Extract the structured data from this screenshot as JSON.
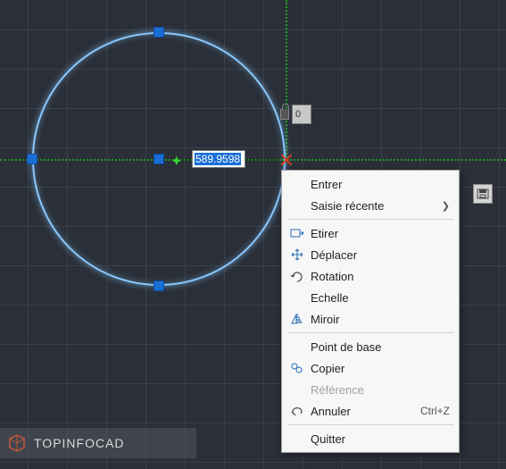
{
  "dynamic_input": {
    "value": "589.9598"
  },
  "angle_input": {
    "value": "0"
  },
  "context_menu": {
    "items": [
      {
        "label": "Entrer"
      },
      {
        "label": "Saisie récente",
        "submenu": true
      }
    ],
    "items2": [
      {
        "label": "Etirer",
        "icon": "stretch"
      },
      {
        "label": "Déplacer",
        "icon": "move"
      },
      {
        "label": "Rotation",
        "icon": "rotate"
      },
      {
        "label": "Echelle"
      },
      {
        "label": "Miroir",
        "icon": "mirror"
      }
    ],
    "items3": [
      {
        "label": "Point de base"
      },
      {
        "label": "Copier",
        "icon": "copy"
      },
      {
        "label": "Référence",
        "disabled": true
      },
      {
        "label": "Annuler",
        "shortcut": "Ctrl+Z",
        "icon": "undo"
      }
    ],
    "items4": [
      {
        "label": "Quitter"
      }
    ]
  },
  "watermark": {
    "text": "TOPINFOCAD"
  }
}
